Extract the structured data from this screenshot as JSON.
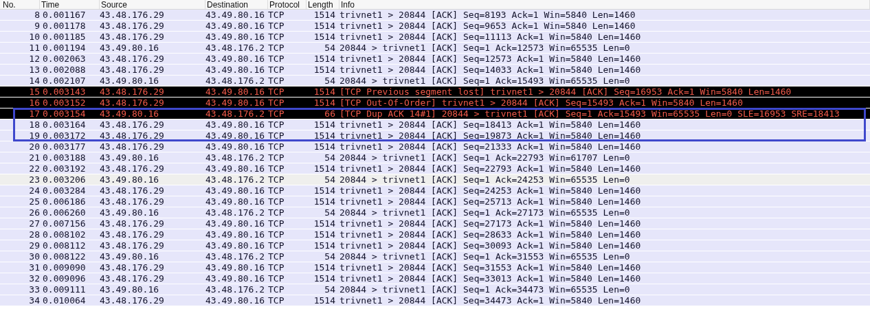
{
  "table": {
    "columns": [
      "No.",
      "Time",
      "Source",
      "Destination",
      "Protocol",
      "Length",
      "Info"
    ],
    "annotation": {
      "color": "#3f48cc"
    },
    "rows": [
      {
        "kind": "tcp",
        "boxed": false,
        "cells": [
          "8",
          "0.001167",
          "43.48.176.29",
          "43.49.80.16",
          "TCP",
          "1514",
          "trivnet1 > 20844 [ACK] Seq=8193 Ack=1 Win=5840 Len=1460"
        ]
      },
      {
        "kind": "tcp",
        "boxed": false,
        "cells": [
          "9",
          "0.001178",
          "43.48.176.29",
          "43.49.80.16",
          "TCP",
          "1514",
          "trivnet1 > 20844 [ACK] Seq=9653 Ack=1 Win=5840 Len=1460"
        ]
      },
      {
        "kind": "tcp",
        "boxed": false,
        "cells": [
          "10",
          "0.001185",
          "43.48.176.29",
          "43.49.80.16",
          "TCP",
          "1514",
          "trivnet1 > 20844 [ACK] Seq=11113 Ack=1 Win=5840 Len=1460"
        ]
      },
      {
        "kind": "tcp",
        "boxed": false,
        "cells": [
          "11",
          "0.001194",
          "43.49.80.16",
          "43.48.176.2",
          "TCP",
          "54",
          "20844 > trivnet1 [ACK] Seq=1 Ack=12573 Win=65535 Len=0"
        ]
      },
      {
        "kind": "tcp",
        "boxed": false,
        "cells": [
          "12",
          "0.002063",
          "43.48.176.29",
          "43.49.80.16",
          "TCP",
          "1514",
          "trivnet1 > 20844 [ACK] Seq=12573 Ack=1 Win=5840 Len=1460"
        ]
      },
      {
        "kind": "tcp",
        "boxed": false,
        "cells": [
          "13",
          "0.002088",
          "43.48.176.29",
          "43.49.80.16",
          "TCP",
          "1514",
          "trivnet1 > 20844 [ACK] Seq=14033 Ack=1 Win=5840 Len=1460"
        ]
      },
      {
        "kind": "tcp",
        "boxed": false,
        "cells": [
          "14",
          "0.002107",
          "43.49.80.16",
          "43.48.176.2",
          "TCP",
          "54",
          "20844 > trivnet1 [ACK] Seq=1 Ack=15493 Win=65535 Len=0"
        ]
      },
      {
        "kind": "bad-tcp",
        "boxed": false,
        "cells": [
          "15",
          "0.003143",
          "43.48.176.29",
          "43.49.80.16",
          "TCP",
          "1514",
          "[TCP Previous segment lost] trivnet1 > 20844 [ACK] Seq=16953 Ack=1 Win=5840 Len=1460"
        ]
      },
      {
        "kind": "bad-tcp",
        "boxed": false,
        "cells": [
          "16",
          "0.003152",
          "43.48.176.29",
          "43.49.80.16",
          "TCP",
          "1514",
          "[TCP Out-Of-Order] trivnet1 > 20844 [ACK] Seq=15493 Ack=1 Win=5840 Len=1460"
        ]
      },
      {
        "kind": "bad-tcp",
        "boxed": true,
        "cells": [
          "17",
          "0.003154",
          "43.49.80.16",
          "43.48.176.2",
          "TCP",
          "66",
          "[TCP Dup ACK 14#1] 20844 > trivnet1 [ACK] Seq=1 Ack=15493 Win=65535 Len=0 SLE=16953 SRE=18413"
        ]
      },
      {
        "kind": "tcp",
        "boxed": true,
        "cells": [
          "18",
          "0.003164",
          "43.48.176.29",
          "43.49.80.16",
          "TCP",
          "1514",
          "trivnet1 > 20844 [ACK] Seq=18413 Ack=1 Win=5840 Len=1460"
        ]
      },
      {
        "kind": "tcp",
        "boxed": true,
        "cells": [
          "19",
          "0.003172",
          "43.48.176.29",
          "43.49.80.16",
          "TCP",
          "1514",
          "trivnet1 > 20844 [ACK] Seq=19873 Ack=1 Win=5840 Len=1460"
        ]
      },
      {
        "kind": "tcp",
        "boxed": false,
        "cells": [
          "20",
          "0.003177",
          "43.48.176.29",
          "43.49.80.16",
          "TCP",
          "1514",
          "trivnet1 > 20844 [ACK] Seq=21333 Ack=1 Win=5840 Len=1460"
        ]
      },
      {
        "kind": "tcp",
        "boxed": false,
        "cells": [
          "21",
          "0.003188",
          "43.49.80.16",
          "43.48.176.2",
          "TCP",
          "54",
          "20844 > trivnet1 [ACK] Seq=1 Ack=22793 Win=61707 Len=0"
        ]
      },
      {
        "kind": "tcp",
        "boxed": false,
        "cells": [
          "22",
          "0.003192",
          "43.48.176.29",
          "43.49.80.16",
          "TCP",
          "1514",
          "trivnet1 > 20844 [ACK] Seq=22793 Ack=1 Win=5840 Len=1460"
        ]
      },
      {
        "kind": "plain",
        "boxed": false,
        "cells": [
          "23",
          "0.003206",
          "43.49.80.16",
          "43.48.176.2",
          "TCP",
          "54",
          "20844 > trivnet1 [ACK] Seq=1 Ack=24253 Win=65535 Len=0"
        ]
      },
      {
        "kind": "tcp",
        "boxed": false,
        "cells": [
          "24",
          "0.003284",
          "43.48.176.29",
          "43.49.80.16",
          "TCP",
          "1514",
          "trivnet1 > 20844 [ACK] Seq=24253 Ack=1 Win=5840 Len=1460"
        ]
      },
      {
        "kind": "tcp",
        "boxed": false,
        "cells": [
          "25",
          "0.006186",
          "43.48.176.29",
          "43.49.80.16",
          "TCP",
          "1514",
          "trivnet1 > 20844 [ACK] Seq=25713 Ack=1 Win=5840 Len=1460"
        ]
      },
      {
        "kind": "tcp",
        "boxed": false,
        "cells": [
          "26",
          "0.006260",
          "43.49.80.16",
          "43.48.176.2",
          "TCP",
          "54",
          "20844 > trivnet1 [ACK] Seq=1 Ack=27173 Win=65535 Len=0"
        ]
      },
      {
        "kind": "tcp",
        "boxed": false,
        "cells": [
          "27",
          "0.007156",
          "43.48.176.29",
          "43.49.80.16",
          "TCP",
          "1514",
          "trivnet1 > 20844 [ACK] Seq=27173 Ack=1 Win=5840 Len=1460"
        ]
      },
      {
        "kind": "tcp",
        "boxed": false,
        "cells": [
          "28",
          "0.008102",
          "43.48.176.29",
          "43.49.80.16",
          "TCP",
          "1514",
          "trivnet1 > 20844 [ACK] Seq=28633 Ack=1 Win=5840 Len=1460"
        ]
      },
      {
        "kind": "tcp",
        "boxed": false,
        "cells": [
          "29",
          "0.008112",
          "43.48.176.29",
          "43.49.80.16",
          "TCP",
          "1514",
          "trivnet1 > 20844 [ACK] Seq=30093 Ack=1 Win=5840 Len=1460"
        ]
      },
      {
        "kind": "tcp",
        "boxed": false,
        "cells": [
          "30",
          "0.008122",
          "43.49.80.16",
          "43.48.176.2",
          "TCP",
          "54",
          "20844 > trivnet1 [ACK] Seq=1 Ack=31553 Win=65535 Len=0"
        ]
      },
      {
        "kind": "tcp",
        "boxed": false,
        "cells": [
          "31",
          "0.009090",
          "43.48.176.29",
          "43.49.80.16",
          "TCP",
          "1514",
          "trivnet1 > 20844 [ACK] Seq=31553 Ack=1 Win=5840 Len=1460"
        ]
      },
      {
        "kind": "tcp",
        "boxed": false,
        "cells": [
          "32",
          "0.009096",
          "43.48.176.29",
          "43.49.80.16",
          "TCP",
          "1514",
          "trivnet1 > 20844 [ACK] Seq=33013 Ack=1 Win=5840 Len=1460"
        ]
      },
      {
        "kind": "tcp",
        "boxed": false,
        "cells": [
          "33",
          "0.009111",
          "43.49.80.16",
          "43.48.176.2",
          "TCP",
          "54",
          "20844 > trivnet1 [ACK] Seq=1 Ack=34473 Win=65535 Len=0"
        ]
      },
      {
        "kind": "tcp",
        "boxed": false,
        "cells": [
          "34",
          "0.010064",
          "43.48.176.29",
          "43.49.80.16",
          "TCP",
          "1514",
          "trivnet1 > 20844 [ACK] Seq=34473 Ack=1 Win=5840 Len=1460"
        ]
      }
    ]
  }
}
